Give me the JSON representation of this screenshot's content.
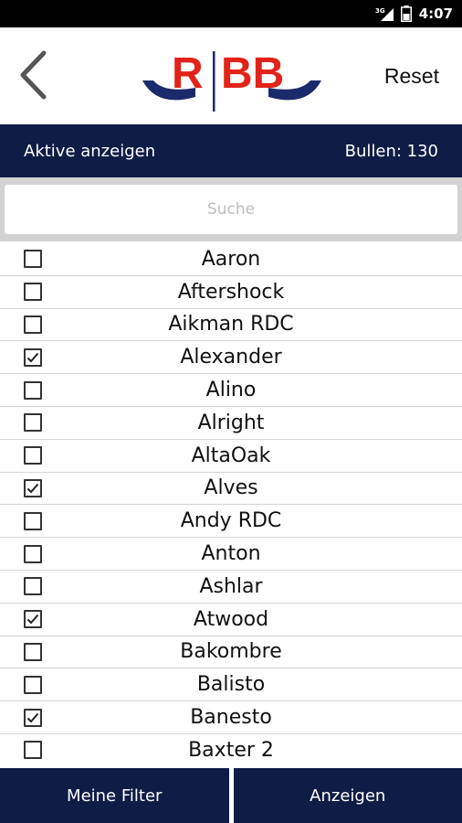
{
  "status_bar": {
    "network": "3G",
    "time": "4:07"
  },
  "header": {
    "logo_text": "RBB",
    "reset_label": "Reset"
  },
  "info_bar": {
    "show_active_label": "Aktive anzeigen",
    "count_label": "Bullen: 130"
  },
  "search": {
    "placeholder": "Suche",
    "value": ""
  },
  "bulls": [
    {
      "name": "Aaron",
      "checked": false
    },
    {
      "name": "Aftershock",
      "checked": false
    },
    {
      "name": "Aikman RDC",
      "checked": false
    },
    {
      "name": "Alexander",
      "checked": true
    },
    {
      "name": "Alino",
      "checked": false
    },
    {
      "name": "Alright",
      "checked": false
    },
    {
      "name": "AltaOak",
      "checked": false
    },
    {
      "name": "Alves",
      "checked": true
    },
    {
      "name": "Andy RDC",
      "checked": false
    },
    {
      "name": "Anton",
      "checked": false
    },
    {
      "name": "Ashlar",
      "checked": false
    },
    {
      "name": "Atwood",
      "checked": true
    },
    {
      "name": "Bakombre",
      "checked": false
    },
    {
      "name": "Balisto",
      "checked": false
    },
    {
      "name": "Banesto",
      "checked": true
    },
    {
      "name": "Baxter 2",
      "checked": false
    }
  ],
  "bottom_bar": {
    "my_filters_label": "Meine Filter",
    "show_label": "Anzeigen"
  },
  "colors": {
    "navy": "#0f1c45",
    "logo_red": "#e2231a",
    "logo_navy": "#1b2a6b"
  }
}
